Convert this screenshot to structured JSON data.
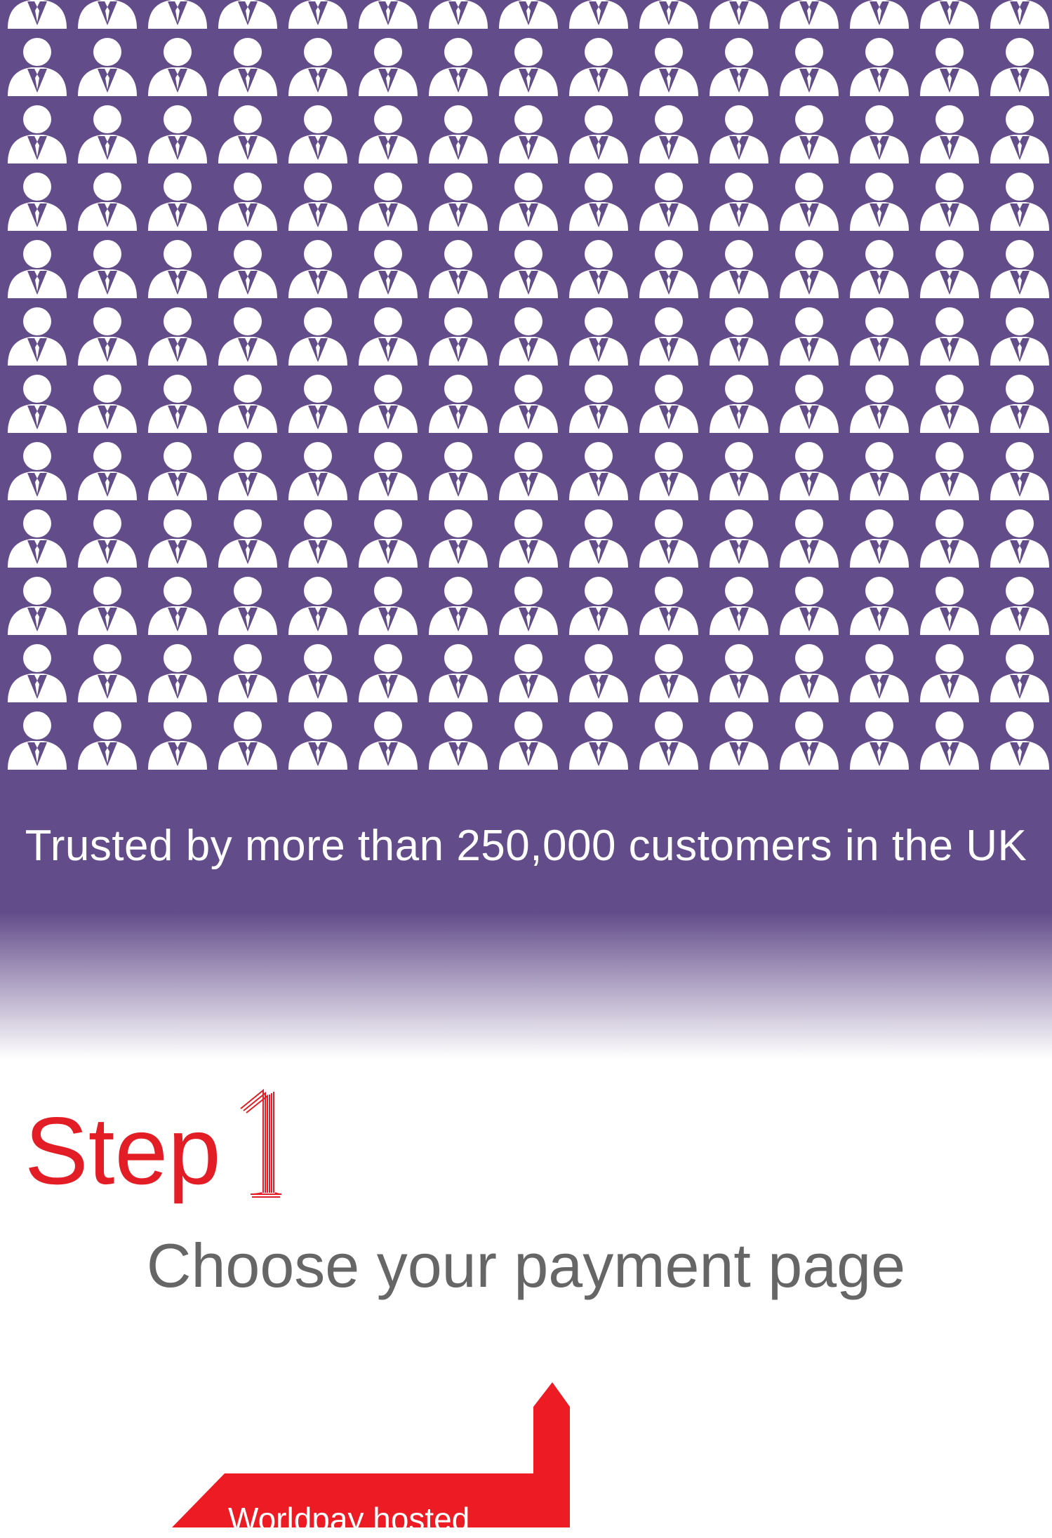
{
  "hero": {
    "background_color": "#634c8a",
    "icon": "person-icon",
    "icon_color": "#ffffff",
    "tagline": "Trusted by more than 250,000 customers in the UK"
  },
  "step": {
    "word": "Step",
    "number": "1",
    "accent_color": "#e31d25"
  },
  "section": {
    "title": "Choose your payment page"
  },
  "banner": {
    "color": "#ed1c24",
    "label": "Worldpay hosted"
  }
}
